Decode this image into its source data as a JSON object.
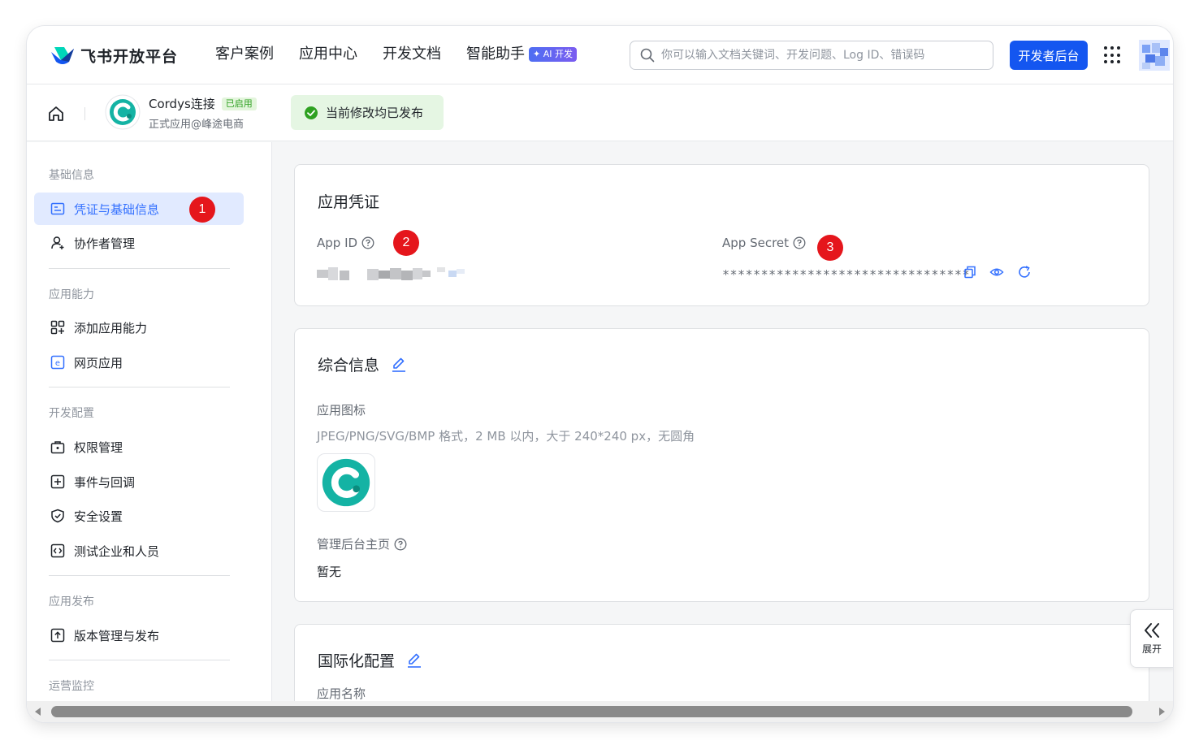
{
  "header": {
    "brand": "飞书开放平台",
    "nav": [
      {
        "label": "客户案例"
      },
      {
        "label": "应用中心"
      },
      {
        "label": "开发文档"
      },
      {
        "label": "智能助手",
        "badge": "✦ AI 开发"
      }
    ],
    "search_placeholder": "你可以输入文档关键词、开发问题、Log ID、错误码",
    "dev_console_button": "开发者后台"
  },
  "app": {
    "name": "Cordys连接",
    "status": "已启用",
    "subtitle": "正式应用@峰途电商",
    "publish_status": "当前修改均已发布"
  },
  "sidebar": {
    "groups": [
      {
        "title": "基础信息",
        "items": [
          {
            "label": "凭证与基础信息",
            "icon": "credential-icon",
            "active": true
          },
          {
            "label": "协作者管理",
            "icon": "user-add-icon"
          }
        ]
      },
      {
        "title": "应用能力",
        "items": [
          {
            "label": "添加应用能力",
            "icon": "apps-add-icon"
          },
          {
            "label": "网页应用",
            "icon": "web-app-icon"
          }
        ]
      },
      {
        "title": "开发配置",
        "items": [
          {
            "label": "权限管理",
            "icon": "permission-icon"
          },
          {
            "label": "事件与回调",
            "icon": "event-icon"
          },
          {
            "label": "安全设置",
            "icon": "shield-icon"
          },
          {
            "label": "测试企业和人员",
            "icon": "code-icon"
          }
        ]
      },
      {
        "title": "应用发布",
        "items": [
          {
            "label": "版本管理与发布",
            "icon": "upload-icon"
          }
        ]
      },
      {
        "title": "运营监控",
        "items": []
      }
    ]
  },
  "annotations": {
    "one": "1",
    "two": "2",
    "three": "3"
  },
  "credentials": {
    "title": "应用凭证",
    "app_id_label": "App ID",
    "app_secret_label": "App Secret",
    "app_secret_value": "********************************"
  },
  "general": {
    "title": "综合信息",
    "icon_label": "应用图标",
    "icon_hint": "JPEG/PNG/SVG/BMP 格式，2 MB 以内，大于 240*240 px，无圆角",
    "homepage_label": "管理后台主页",
    "homepage_value": "暂无"
  },
  "i18n": {
    "title": "国际化配置",
    "app_name_label": "应用名称"
  },
  "expand_label": "展开",
  "colors": {
    "primary": "#1456f0",
    "accent": "#3370ff",
    "success": "#2ea121",
    "annotation": "#e5161c"
  }
}
